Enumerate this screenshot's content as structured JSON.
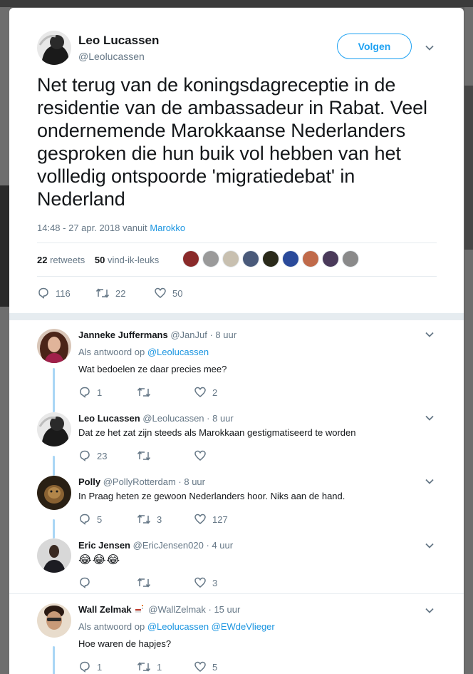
{
  "tweet": {
    "author_name": "Leo Lucassen",
    "author_handle": "@Leolucassen",
    "follow_label": "Volgen",
    "text": "Net terug van de koningsdagreceptie in de residentie van de ambassadeur in Rabat. Veel ondernemende Marokkaanse Nederlanders gesproken die hun buik vol hebben van het vollledig ontspoorde 'migratiedebat' in Nederland",
    "timestamp": "14:48 - 27 apr. 2018 vanuit",
    "location": "Marokko",
    "retweets_count": "22",
    "retweets_label": "retweets",
    "likes_count": "50",
    "likes_label": "vind-ik-leuks",
    "action_replies": "116",
    "action_retweets": "22",
    "action_likes": "50",
    "liker_colors": [
      "#8a2a2a",
      "#9a9a9a",
      "#c8c0b0",
      "#4a5a7a",
      "#2a2a1a",
      "#2a4a9a",
      "#c06a4a",
      "#4a3a5a",
      "#8a8a8a"
    ]
  },
  "replies": [
    {
      "name": "Janneke Juffermans",
      "handle": "@JanJuf",
      "time": "· 8 uur",
      "context_prefix": "Als antwoord op",
      "context_mentions": "@Leolucassen",
      "text": "Wat bedoelen ze daar precies mee?",
      "replies": "1",
      "retweets": "",
      "likes": "2"
    },
    {
      "name": "Leo Lucassen",
      "handle": "@Leolucassen",
      "time": "· 8 uur",
      "text": "Dat ze het zat zijn steeds als Marokkaan gestigmatiseerd te worden",
      "replies": "23",
      "retweets": "",
      "likes": ""
    },
    {
      "name": "Polly",
      "handle": "@PollyRotterdam",
      "time": "· 8 uur",
      "text": "In Praag heten ze gewoon Nederlanders hoor. Niks aan de hand.",
      "replies": "5",
      "retweets": "3",
      "likes": "127"
    },
    {
      "name": "Eric Jensen",
      "handle": "@EricJensen020",
      "time": "· 4 uur",
      "text": "😂😂😂",
      "replies": "",
      "retweets": "",
      "likes": "3"
    },
    {
      "name": "Wall Zelmak",
      "handle": "@WallZelmak",
      "time": "· 15 uur",
      "context_prefix": "Als antwoord op",
      "context_mentions": "@Leolucassen @EWdeVlieger",
      "text": "Hoe waren de hapjes?",
      "replies": "1",
      "retweets": "1",
      "likes": "5"
    }
  ],
  "colors": {
    "accent": "#1da1f2",
    "link": "#1b95e0",
    "muted": "#657786",
    "thread": "#a9d6f5"
  }
}
